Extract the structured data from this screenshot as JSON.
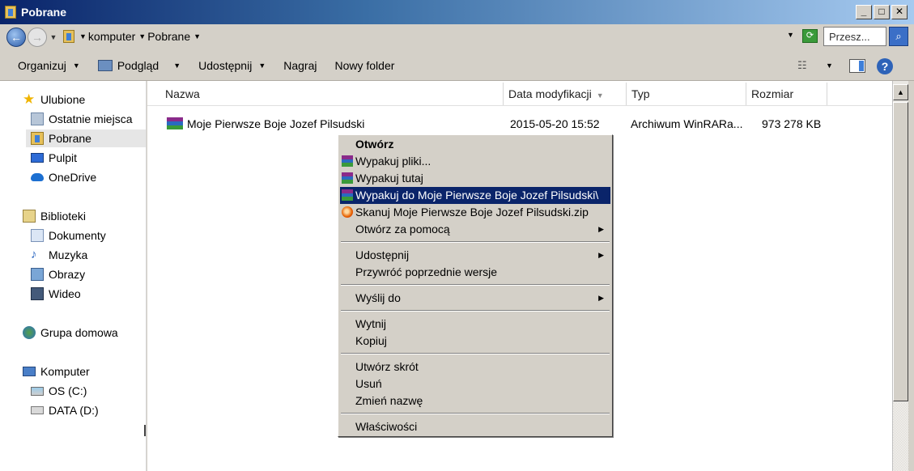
{
  "window": {
    "title": "Pobrane"
  },
  "address": {
    "crumbs": [
      "komputer",
      "Pobrane"
    ],
    "search_placeholder": "Przesz..."
  },
  "toolbar": {
    "organize": "Organizuj",
    "preview": "Podgląd",
    "share": "Udostępnij",
    "burn": "Nagraj",
    "new_folder": "Nowy folder"
  },
  "nav": {
    "favorites": "Ulubione",
    "recent": "Ostatnie miejsca",
    "downloads": "Pobrane",
    "desktop": "Pulpit",
    "onedrive": "OneDrive",
    "libraries": "Biblioteki",
    "documents": "Dokumenty",
    "music": "Muzyka",
    "pictures": "Obrazy",
    "video": "Wideo",
    "homegroup": "Grupa domowa",
    "computer": "Komputer",
    "drive_c": "OS (C:)",
    "drive_d": "DATA (D:)"
  },
  "columns": {
    "name": "Nazwa",
    "date": "Data modyfikacji",
    "type": "Typ",
    "size": "Rozmiar"
  },
  "file": {
    "name": "Moje Pierwsze Boje Jozef Pilsudski",
    "date": "2015-05-20 15:52",
    "type": "Archiwum WinRARa...",
    "size": "973 278 KB"
  },
  "menu": {
    "open": "Otwórz",
    "extract_files": "Wypakuj pliki...",
    "extract_here": "Wypakuj tutaj",
    "extract_to": "Wypakuj do Moje Pierwsze Boje Jozef Pilsudski\\",
    "scan": "Skanuj Moje Pierwsze Boje Jozef Pilsudski.zip",
    "open_with": "Otwórz za pomocą",
    "share": "Udostępnij",
    "restore": "Przywróć poprzednie wersje",
    "send_to": "Wyślij do",
    "cut": "Wytnij",
    "copy": "Kopiuj",
    "create_shortcut": "Utwórz skrót",
    "delete": "Usuń",
    "rename": "Zmień nazwę",
    "properties": "Właściwości"
  }
}
